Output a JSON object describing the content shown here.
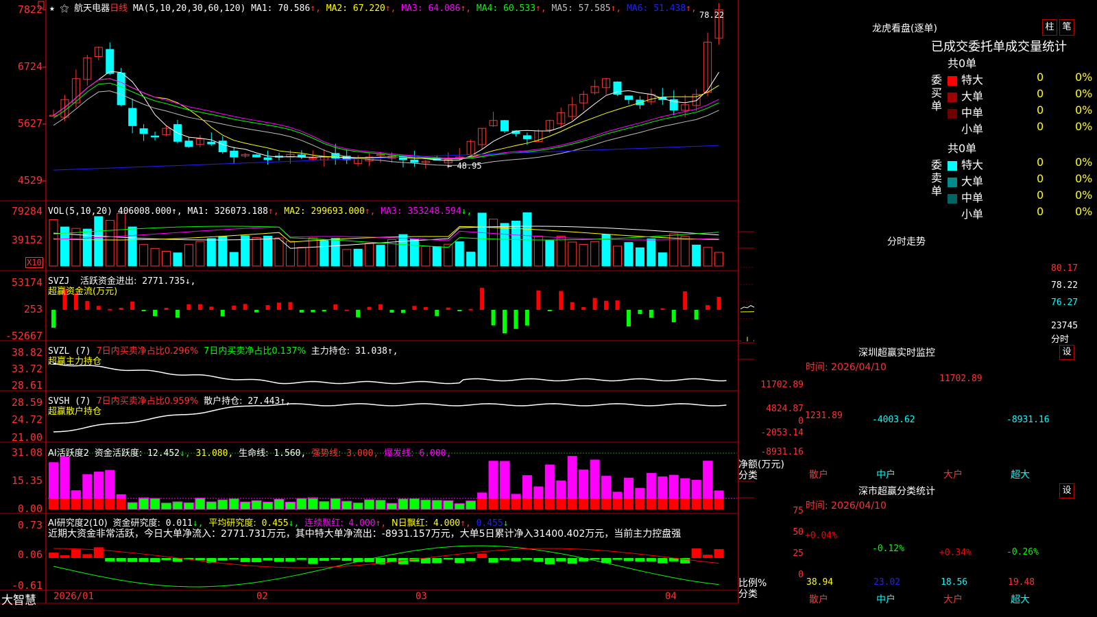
{
  "app": {
    "brand": "大智慧"
  },
  "main": {
    "stock_name": "航天电器",
    "period": "日线",
    "ma_header": "MA(5,10,20,30,60,120)",
    "ma_values": [
      {
        "label": "MA1:",
        "value": "70.586",
        "color": "#ffffff"
      },
      {
        "label": "MA2:",
        "value": "67.220",
        "color": "#ffff00"
      },
      {
        "label": "MA3:",
        "value": "64.086",
        "color": "#ff00ff"
      },
      {
        "label": "MA4:",
        "value": "60.533",
        "color": "#00ff00"
      },
      {
        "label": "MA5:",
        "value": "57.585",
        "color": "#c0c0c0"
      },
      {
        "label": "MA6:",
        "value": "51.438",
        "color": "#2020ff"
      }
    ],
    "price_axis": [
      "7822",
      "6724",
      "5627",
      "4529"
    ],
    "high_label": "78.22",
    "low_label": "48.95"
  },
  "volume": {
    "header": "VOL(5,10,20)",
    "value": "406008.000",
    "mas": [
      {
        "label": "MA1:",
        "value": "326073.188",
        "color": "#ffffff",
        "arrow": "↑"
      },
      {
        "label": "MA2:",
        "value": "299693.000",
        "color": "#ffff00",
        "arrow": "↑"
      },
      {
        "label": "MA3:",
        "value": "353248.594",
        "color": "#ff00ff",
        "arrow": "↓"
      }
    ],
    "axis": [
      "79284",
      "39152"
    ],
    "unit": "X10"
  },
  "svzj": {
    "header": "SVZJ",
    "label": "活跃资金进出:",
    "value": "2771.735",
    "subtitle": "超赢资金流(万元)",
    "axis": [
      "53174",
      "253",
      "-52667"
    ]
  },
  "svzl": {
    "header": "SVZL (7)",
    "sell_label": "7日内买卖净占比0.296%",
    "buy_label": "7日内买卖净占比0.137%",
    "hold_label": "主力持仓:",
    "hold_value": "31.038",
    "subtitle": "超赢主力持仓",
    "axis": [
      "38.82",
      "33.72",
      "28.61"
    ]
  },
  "svsh": {
    "header": "SVSH (7)",
    "ratio_label": "7日内买卖净占比0.959%",
    "hold_label": "散户持仓:",
    "hold_value": "27.443",
    "subtitle": "超赢散户持仓",
    "axis": [
      "28.59",
      "24.72",
      "21.00"
    ]
  },
  "ai_active": {
    "header": "AI活跃度2",
    "label": "资金活跃度:",
    "value": "12.452",
    "v2": "31.080",
    "life_label": "生命线:",
    "life_value": "1.560",
    "strong_label": "强势线:",
    "strong_value": "3.000",
    "burst_label": "爆发线:",
    "burst_value": "6.000",
    "axis": [
      "31.08",
      "15.35",
      "0.00"
    ]
  },
  "ai_research": {
    "header": "AI研究度2(10)",
    "label": "资金研究度:",
    "value": "0.011",
    "avg_label": "平均研究度:",
    "avg_value": "0.455",
    "cont_label": "连续飘红:",
    "cont_value": "4.000",
    "n_label": "N日飘红:",
    "n_value": "4.000",
    "last_value": "0.455",
    "comment": "近期大资金非常活跃，今日大单净流入：2771.731万元，其中特大单净流出：-8931.157万元，大单5日累计净入31400.402万元，当前主力控盘强",
    "axis": [
      "0.73",
      "0.06",
      "-0.61"
    ]
  },
  "time_axis": [
    "2026/01",
    "02",
    "03",
    "04"
  ],
  "lhb": {
    "title": "龙虎看盘(逐单)",
    "btn_bar": "柱",
    "btn_pen": "笔",
    "tab_header": "已成交委托单成交量统计",
    "buy": {
      "side_label": "委买单",
      "total": "共0单",
      "rows": [
        {
          "name": "特大",
          "count": "0",
          "pct": "0%",
          "color": "#ff0000"
        },
        {
          "name": "大单",
          "count": "0",
          "pct": "0%",
          "color": "#a00000"
        },
        {
          "name": "中单",
          "count": "0",
          "pct": "0%",
          "color": "#700000"
        },
        {
          "name": "小单",
          "count": "0",
          "pct": "0%",
          "color": ""
        }
      ]
    },
    "sell": {
      "side_label": "委卖单",
      "total": "共0单",
      "rows": [
        {
          "name": "特大",
          "count": "0",
          "pct": "0%",
          "color": "#00ffff"
        },
        {
          "name": "大单",
          "count": "0",
          "pct": "0%",
          "color": "#008c8c"
        },
        {
          "name": "中单",
          "count": "0",
          "pct": "0%",
          "color": "#006464"
        },
        {
          "name": "小单",
          "count": "0",
          "pct": "0%",
          "color": ""
        }
      ]
    }
  },
  "intraday": {
    "title": "分时走势",
    "price_labels": [
      "80.17",
      "78.22",
      "76.27"
    ],
    "vol_label": "23745",
    "x_label": "分时"
  },
  "sz_monitor": {
    "title": "深圳超赢实时监控",
    "btn": "设",
    "time": "时间: 2026/04/10",
    "y_labels": [
      "11702.89",
      "4824.87",
      "0",
      "-2053.14",
      "-8931.16"
    ],
    "y_title": "净额(万元)",
    "x_title": "分类",
    "bars": [
      {
        "cat": "散户",
        "value": 1231.89,
        "label": "1231.89"
      },
      {
        "cat": "中户",
        "value": -4003.62,
        "label": "-4003.62"
      },
      {
        "cat": "大户",
        "value": 11702.89,
        "label": "11702.89"
      },
      {
        "cat": "超大",
        "value": -8931.16,
        "label": "-8931.16"
      }
    ]
  },
  "sz_category": {
    "title": "深市超赢分类统计",
    "btn": "设",
    "time": "时间: 2026/04/10",
    "y_labels": [
      "75",
      "50",
      "25",
      "0"
    ],
    "y_title": "比例%",
    "x_title": "分类",
    "bars": [
      {
        "cat": "散户",
        "value": 38.94,
        "label": "38.94",
        "change": "+0.04%",
        "color": "#ff0000",
        "fill": "#ffffff"
      },
      {
        "cat": "中户",
        "value": 23.02,
        "label": "23.02",
        "change": "-0.12%",
        "color": "#00ff00",
        "fill": "#2020ff"
      },
      {
        "cat": "大户",
        "value": 18.56,
        "label": "18.56",
        "change": "+0.34%",
        "color": "#ff0000",
        "fill": "#00ffff"
      },
      {
        "cat": "超大",
        "value": 19.48,
        "label": "19.48",
        "change": "-0.26%",
        "color": "#00ff00",
        "fill": "#ff3232"
      }
    ]
  }
}
